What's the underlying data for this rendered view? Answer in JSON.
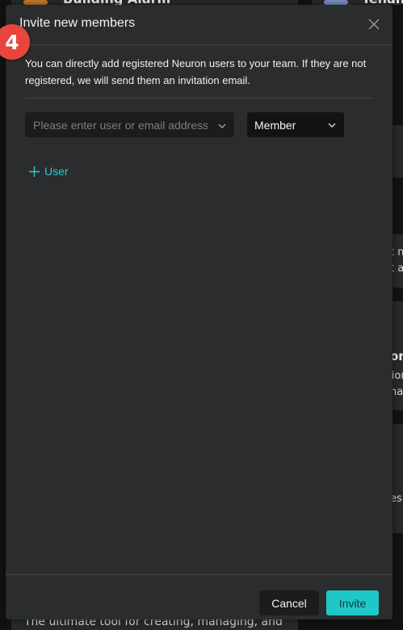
{
  "background": {
    "card_top_left_title": "Building Alarm",
    "card_top_right_title": "Tenan",
    "card_bottom_description": "The ultimate tool for creating, managing, and",
    "right_fragments": [
      "t m",
      "t a",
      "on",
      "sion",
      "nag",
      "es"
    ]
  },
  "modal": {
    "title": "Invite new members",
    "step_number": "4",
    "description": "You can directly add registered Neuron users to your team. If they are not registered, we will send them an invitation email.",
    "user_input": {
      "value": "",
      "placeholder": "Please enter user or email address"
    },
    "role_select": {
      "selected": "Member"
    },
    "add_user_label": "User",
    "cancel_label": "Cancel",
    "invite_label": "Invite"
  },
  "colors": {
    "accent": "#1ec8c8",
    "badge": "#e8453c",
    "modal_bg": "#2b2c2e"
  }
}
